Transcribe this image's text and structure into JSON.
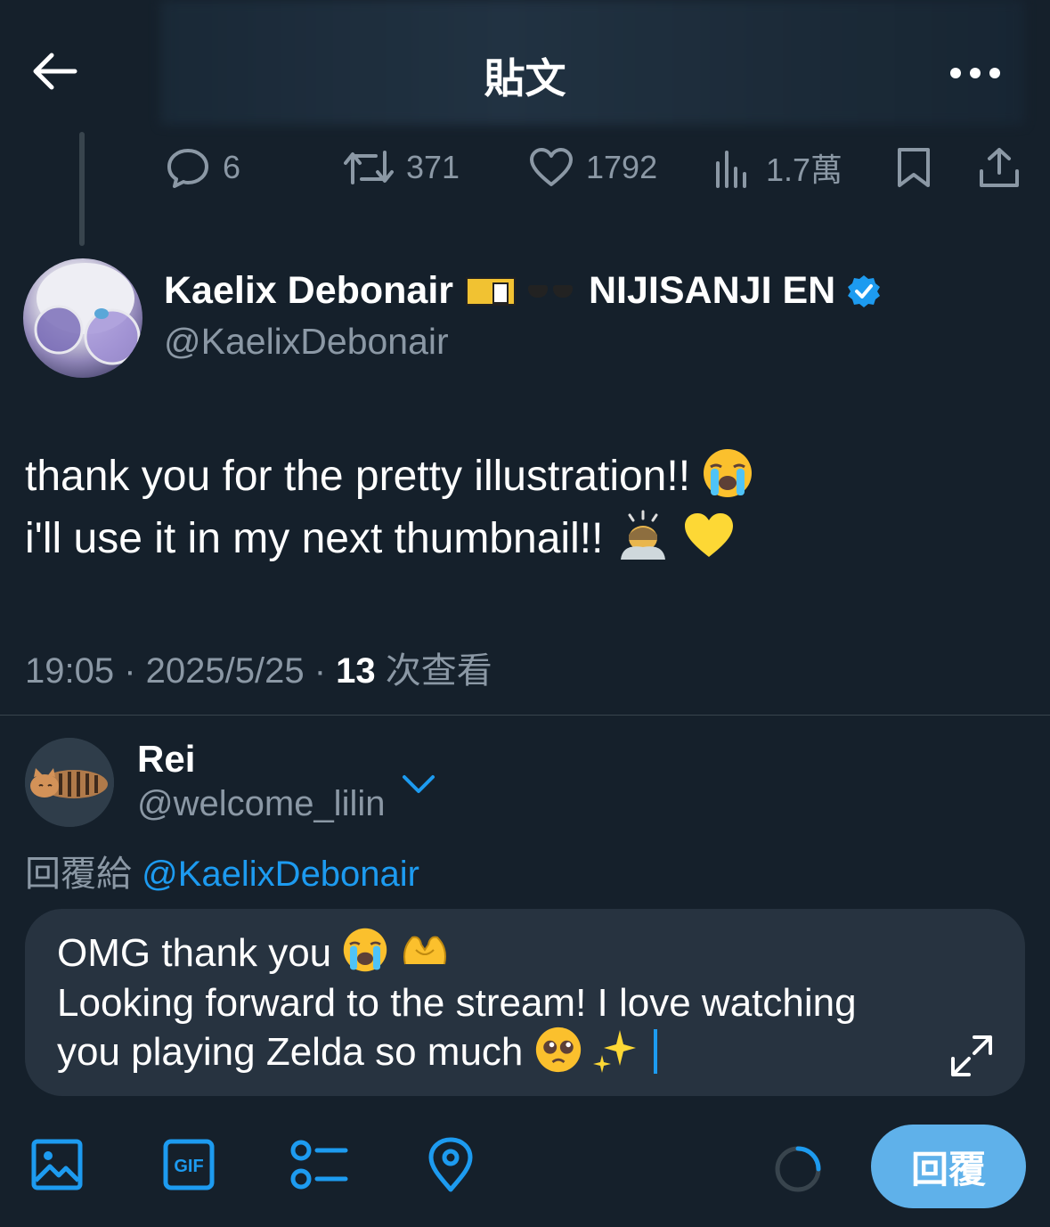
{
  "header": {
    "title": "貼文"
  },
  "stats": {
    "replies": "6",
    "retweets": "371",
    "likes": "1792",
    "views": "1.7萬"
  },
  "tweet": {
    "author_name": "Kaelix Debonair",
    "author_suffix": "NIJISANJI EN",
    "author_handle": "@KaelixDebonair",
    "line1": "thank you for the pretty illustration!!",
    "line2": "i'll use it in my next thumbnail!!",
    "time": "19:05 · 2025/5/25 · ",
    "view_count": "13",
    "view_label": " 次查看"
  },
  "reply": {
    "name": "Rei",
    "handle": "@welcome_lilin",
    "replying_prefix": "回覆給 ",
    "replying_to": "@KaelixDebonair",
    "line1": "OMG thank you",
    "line2": "Looking forward to the stream! I love watching",
    "line3": "you playing Zelda so much"
  },
  "toolbar": {
    "reply_button": "回覆",
    "gif_label": "GIF"
  },
  "colors": {
    "background": "#15202b",
    "accent": "#1d9bf0",
    "muted": "#8b98a5",
    "reply_button": "#5fb1ea"
  }
}
